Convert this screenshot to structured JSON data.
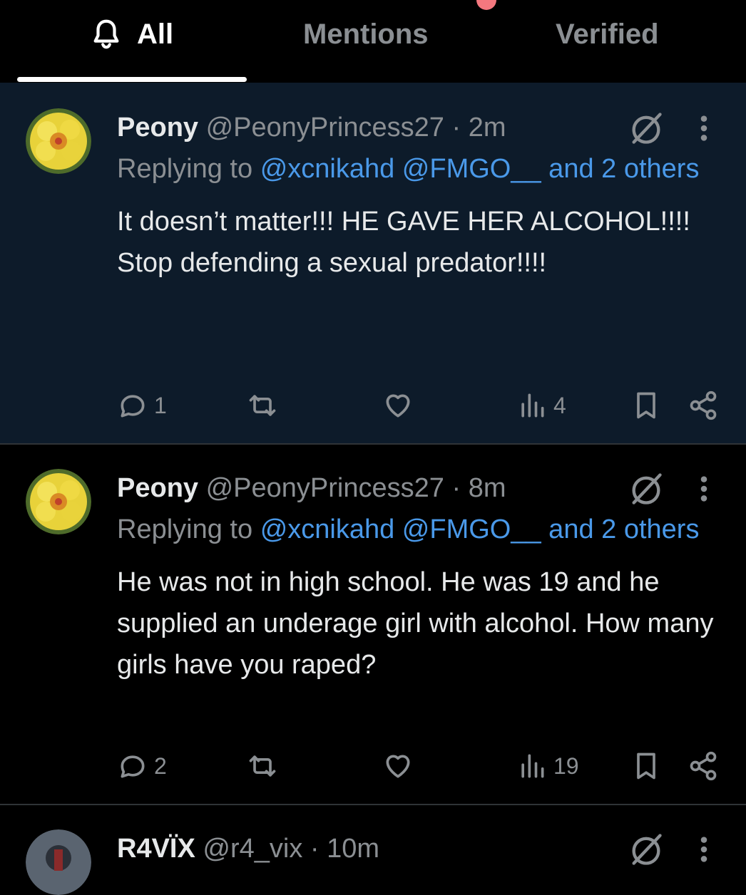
{
  "tabs": [
    {
      "label": "All",
      "icon": "bell-icon",
      "active": true
    },
    {
      "label": "Mentions",
      "active": false
    },
    {
      "label": "Verified",
      "active": false
    }
  ],
  "posts": [
    {
      "name": "Peony",
      "handle": "@PeonyPrincess27",
      "sep": "·",
      "time": "2m",
      "replying_prefix": "Replying to",
      "replying_to": "@xcnikahd @FMGO__ and 2 others",
      "text": "It doesn’t matter!!! HE GAVE HER ALCOHOL!!!! Stop defending a sexual predator!!!!",
      "replies": "1",
      "views": "4",
      "unread": true
    },
    {
      "name": "Peony",
      "handle": "@PeonyPrincess27",
      "sep": "·",
      "time": "8m",
      "replying_prefix": "Replying to",
      "replying_to": "@xcnikahd @FMGO__ and 2 others",
      "text": "He was not in high school. He was 19 and he supplied an underage girl with alcohol. How many girls have you raped?",
      "replies": "2",
      "views": "19",
      "unread": false
    },
    {
      "name": "R4VÏX",
      "handle": "@r4_vix",
      "sep": "·",
      "time": "10m"
    }
  ],
  "colors": {
    "background": "#000000",
    "unread_background": "#0d1b2a",
    "link": "#4a99e9",
    "muted": "#8b8f93",
    "notification_dot": "#f4787f"
  }
}
